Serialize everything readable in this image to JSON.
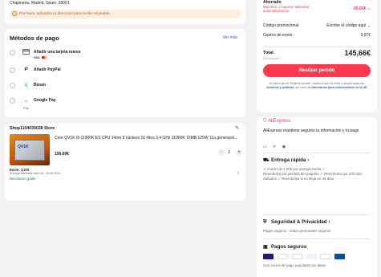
{
  "address": {
    "line": "Chapineria, Madrid, Spain, 28001",
    "warning": "Por favor, actualiza tu dirección para recibir el pedido"
  },
  "payment": {
    "title": "Métodos de pago",
    "more": "Ver más",
    "methods": [
      {
        "label": "Añadir una tarjeta nueva",
        "icon": "credit-card-icon"
      },
      {
        "label": "Añadir PayPal",
        "icon": "paypal-icon"
      },
      {
        "label": "Bizum",
        "icon": "bizum-icon"
      },
      {
        "label": "Google Pay",
        "icon": "google-pay-icon"
      }
    ],
    "brands": {
      "visa": "VISA"
    }
  },
  "store": {
    "name": "Shop1104030038 Store",
    "product": {
      "name": "Core QV1K i9-11900K ES CPU 14nm 8 núcleos 16 hilos 3,4 GHz 11900K 16MB 125W 11a generació...",
      "price": "156,69€",
      "quantity": "1",
      "thumb_text": "QV1K"
    },
    "shipping": {
      "cost": "Envío: 3,97€",
      "eta": "Entrega estimada entre 28 - 30 de NOV.",
      "returns": "Devolución gratis"
    }
  },
  "summary": {
    "saved_title": "Ahorrado",
    "saved_sub": "Más dtos. y cupones aplicados automáticamente",
    "saved_value": "-15,00€",
    "promo_label": "Código promocional",
    "promo_action": "Escribe el código aquí",
    "shipping_label": "Gastos de envío",
    "shipping_value": "3,97€",
    "total_label": "Total",
    "total_value": "145,66€",
    "iva": "IVA incluido",
    "cta": "Realizar pedido",
    "legal_pre": "Al hacer clic en 'Realizar pedido', confirmo que he leído y acepto todos los",
    "legal_link1": "términos y políticas",
    "legal_mid": ", así como la",
    "legal_link2": "información para consumidores en la UE"
  },
  "trust": {
    "logo": "AliExpress",
    "text": "AliExpress mantiene seguros tu información y tu pago",
    "delivery_title": "Entrega rápida",
    "delivery_body1": "Cupón de 1,00€ por entrega tardía",
    "delivery_body2": "Reembolso por pérdida del paquete",
    "delivery_body3": "Reembolso por artículos dañados",
    "delivery_body4": "Reembolso si no llega en 45 días",
    "security_title": "Seguridad & Privacidad",
    "security_body": "Pagos seguros · Datos personales seguros",
    "secure_title": "Pagos seguros",
    "secure_body": "Con socios de pago populares tus datos"
  }
}
